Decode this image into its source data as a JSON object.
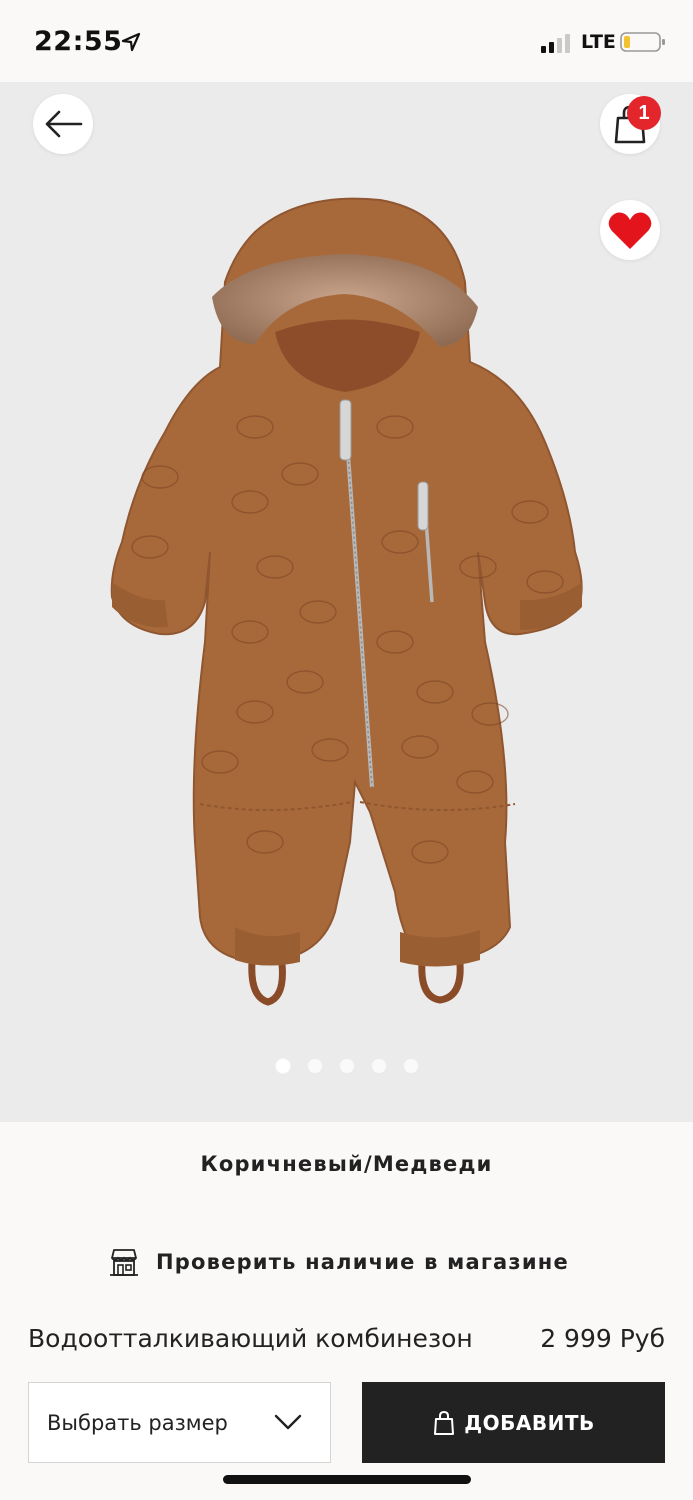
{
  "status_bar": {
    "time": "22:55",
    "network": "LTE",
    "icons": [
      "location-arrow-icon",
      "signal-icon",
      "battery-icon"
    ]
  },
  "top_actions": {
    "back_icon": "arrow-left-icon",
    "bag_icon": "shopping-bag-icon",
    "cart_count": "1",
    "favorite_icon": "heart-icon"
  },
  "gallery": {
    "total_images": 5,
    "active_index": 0
  },
  "product": {
    "color_name": "Коричневый/Медведи",
    "store_check_label": "Проверить наличие в магазине",
    "store_icon": "store-icon",
    "title": "Водоотталкивающий комбинезон",
    "price": "2 999 Руб"
  },
  "actions": {
    "size_select_label": "Выбрать размер",
    "add_button_label": "ДОБАВИТЬ",
    "add_icon": "shopping-bag-icon"
  },
  "colors": {
    "badge": "#e3262b",
    "favorite": "#e3141b",
    "add_button_bg": "#222222",
    "product_brown": "#a8693a"
  }
}
